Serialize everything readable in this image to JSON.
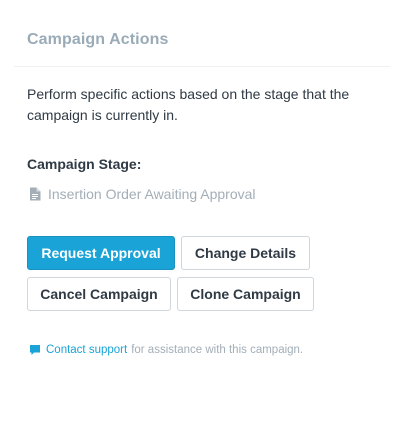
{
  "panel": {
    "title": "Campaign Actions",
    "description": "Perform specific actions based on the stage that the campaign is currently in.",
    "stage_label": "Campaign Stage:",
    "stage_value": "Insertion Order Awaiting Approval",
    "stage_icon": "document-icon"
  },
  "buttons": {
    "request_approval": "Request Approval",
    "change_details": "Change Details",
    "cancel_campaign": "Cancel Campaign",
    "clone_campaign": "Clone Campaign"
  },
  "support": {
    "icon": "chat-bubble-icon",
    "link_text": "Contact support",
    "trailing_text": "for assistance with this campaign."
  },
  "colors": {
    "primary": "#1aa3d6",
    "title": "#9aabb8",
    "muted": "#a3aeb7",
    "text": "#2f3a44"
  }
}
